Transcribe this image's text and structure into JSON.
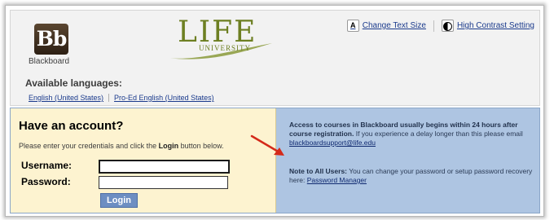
{
  "header": {
    "blackboard_logo_text": "Bb",
    "blackboard_label": "Blackboard",
    "life_logo_word": "LIFE",
    "life_logo_sub": "UNIVERSITY",
    "change_text_size": "Change Text Size",
    "change_text_size_icon_glyph": "A",
    "high_contrast": "High Contrast Setting",
    "languages_heading": "Available languages:",
    "languages": [
      "English (United States)",
      "Pro-Ed English (United States)"
    ]
  },
  "login": {
    "title": "Have an account?",
    "instructions_prefix": "Please enter your credentials and click the ",
    "instructions_bold": "Login",
    "instructions_suffix": " button below.",
    "username_label": "Username:",
    "username_value": "",
    "password_label": "Password:",
    "password_value": "",
    "login_button": "Login"
  },
  "info": {
    "access_bold": "Access to courses in Blackboard usually begins within 24 hours after course registration.",
    "access_text": " If you experience a delay longer than this please email ",
    "support_email": "blackboardsupport@life.edu",
    "note_bold": "Note to All Users:",
    "note_text": " You can change your password or setup password recovery here: ",
    "password_manager_link": "Password Manager"
  },
  "colors": {
    "header_bg": "#f2f2f2",
    "login_bg": "#fdf3d0",
    "info_bg": "#aec5e2",
    "link": "#1a3a8c",
    "login_button": "#6d8ec2",
    "logo_green": "#6d7f22",
    "arrow": "#d42a1a"
  }
}
